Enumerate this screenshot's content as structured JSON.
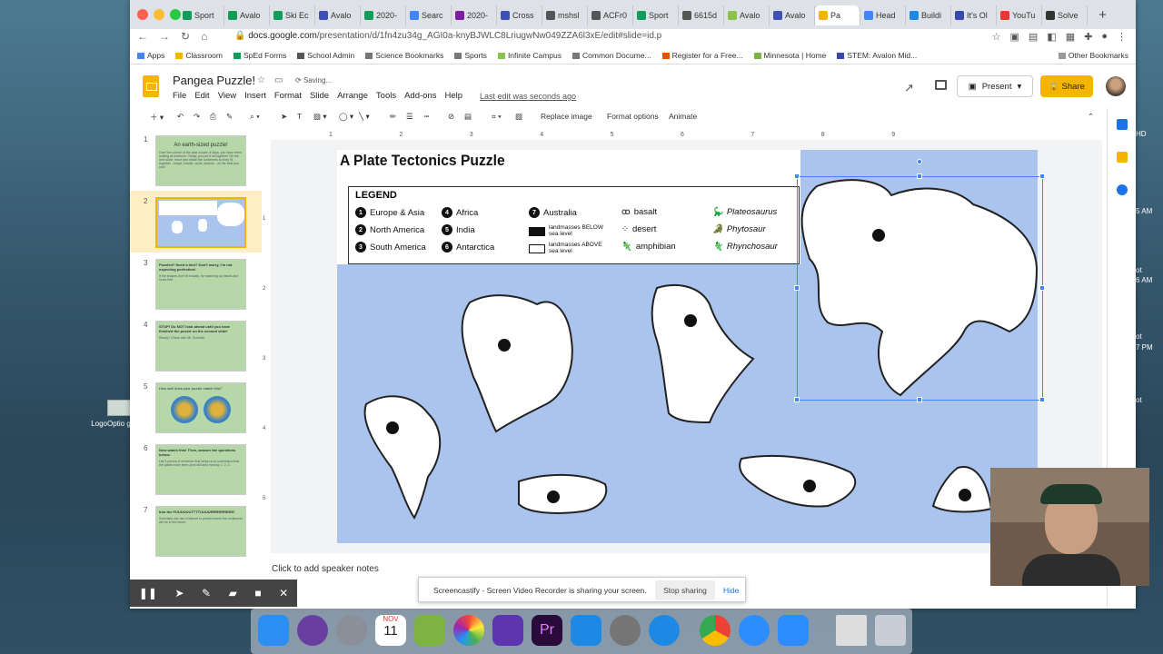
{
  "browser": {
    "tabs": [
      {
        "label": "Sport",
        "color": "#0f9d58"
      },
      {
        "label": "Avalo",
        "color": "#0f9d58"
      },
      {
        "label": "Ski Ec",
        "color": "#0f9d58"
      },
      {
        "label": "Avalo",
        "color": "#3f51b5"
      },
      {
        "label": "2020-",
        "color": "#0f9d58"
      },
      {
        "label": "Searc",
        "color": "#4285f4"
      },
      {
        "label": "2020-",
        "color": "#7b1fa2"
      },
      {
        "label": "Cross",
        "color": "#3f51b5"
      },
      {
        "label": "mshsl",
        "color": "#555555"
      },
      {
        "label": "ACFr0",
        "color": "#555555"
      },
      {
        "label": "Sport",
        "color": "#0f9d58"
      },
      {
        "label": "6615d",
        "color": "#555555"
      },
      {
        "label": "Avalo",
        "color": "#8bc34a"
      },
      {
        "label": "Avalo",
        "color": "#3f51b5"
      },
      {
        "label": "Pa",
        "color": "#f4b400"
      },
      {
        "label": "Head",
        "color": "#4285f4"
      },
      {
        "label": "Buildi",
        "color": "#1e88e5"
      },
      {
        "label": "It's Ol",
        "color": "#3949ab"
      },
      {
        "label": "YouTu",
        "color": "#e53935"
      },
      {
        "label": "Solve",
        "color": "#333333"
      }
    ],
    "url_host": "docs.google.com",
    "url_path": "/presentation/d/1fn4zu34g_AGI0a-knyBJWLC8LriugwNw049ZZA6l3xE/edit#slide=id.p",
    "bookmarks": [
      {
        "label": "Apps",
        "color": "#4285f4"
      },
      {
        "label": "Classroom",
        "color": "#f4b400"
      },
      {
        "label": "SpEd Forms",
        "color": "#0f9d58"
      },
      {
        "label": "School Admin",
        "color": "#555555"
      },
      {
        "label": "Science Bookmarks",
        "color": "#777777"
      },
      {
        "label": "Sports",
        "color": "#777777"
      },
      {
        "label": "Infinite Campus",
        "color": "#8bc34a"
      },
      {
        "label": "Common Docume...",
        "color": "#777777"
      },
      {
        "label": "Register for a Free...",
        "color": "#e65100"
      },
      {
        "label": "Minnesota | Home",
        "color": "#7cb342"
      },
      {
        "label": "STEM: Avalon Mid...",
        "color": "#3949ab"
      }
    ],
    "other_bookmarks": "Other Bookmarks"
  },
  "doc": {
    "title": "Pangea Puzzle!",
    "saving": "Saving...",
    "menu": [
      "File",
      "Edit",
      "View",
      "Insert",
      "Format",
      "Slide",
      "Arrange",
      "Tools",
      "Add-ons",
      "Help"
    ],
    "last_edit": "Last edit was seconds ago",
    "present": "Present",
    "share": "Share"
  },
  "toolbar": {
    "replace_image": "Replace image",
    "format_options": "Format options",
    "animate": "Animate"
  },
  "ruler": [
    "1",
    "2",
    "3",
    "4",
    "5",
    "6",
    "7",
    "8",
    "9"
  ],
  "vruler": [
    "1",
    "2",
    "3",
    "4",
    "5"
  ],
  "thumbnails": [
    {
      "num": "1",
      "title": "An earth-sized puzzle!",
      "body": "Over the course of the past couple of days, you have been looking at evidence. Today, you put it all together! On the next slide, move and rotate the continents so they fit together - shape, fossils, rocks, deserts - do the best you can!"
    },
    {
      "num": "2",
      "title": "",
      "body": ""
    },
    {
      "num": "3",
      "title": "Puzzled? Need a hint? Don't worry, I'm not expecting perfection!",
      "body": "If the shapes don't fit exactly, try matching up fossils and rocks first."
    },
    {
      "num": "4",
      "title": "STOP! Do NOT look ahead until you have finished the puzzle on the second slide!",
      "body": "Ready? Check with Mr. Schmidt."
    },
    {
      "num": "5",
      "title": "How well does your puzzle match this?",
      "body": ""
    },
    {
      "num": "6",
      "title": "Now watch this! Then, answer the questions below:",
      "body": "List 3 pieces of evidence that helps us to understand that the plates have been (and still are) moving: 1. 2. 3."
    },
    {
      "num": "7",
      "title": "Into the FUUUUUUTTTTUUUURRRRRREEE!",
      "body": "Scientists can use evidence to predict where the continents will be in the future."
    }
  ],
  "slide": {
    "title": "A Plate Tectonics Puzzle",
    "legend_title": "LEGEND",
    "legend": [
      {
        "n": "1",
        "label": "Europe & Asia"
      },
      {
        "n": "2",
        "label": "North America"
      },
      {
        "n": "3",
        "label": "South America"
      },
      {
        "n": "4",
        "label": "Africa"
      },
      {
        "n": "5",
        "label": "India"
      },
      {
        "n": "6",
        "label": "Antarctica"
      },
      {
        "n": "7",
        "label": "Australia"
      }
    ],
    "landmass_below": "landmasses BELOW sea level",
    "landmass_above": "landmasses ABOVE sea level",
    "rocks": [
      "basalt",
      "desert",
      "amphibian"
    ],
    "fossils": [
      "Plateosaurus",
      "Phytosaur",
      "Rhynchosaur"
    ],
    "colors": {
      "ocean": "#aac4ee",
      "accent": "#f4b400",
      "select": "#4285f4"
    }
  },
  "notes_placeholder": "Click to add speaker notes",
  "screencast": {
    "message": "Screencastify - Screen Video Recorder is sharing your screen.",
    "stop": "Stop sharing",
    "hide": "Hide"
  },
  "desktop": {
    "logo_label": "LogoOptio g",
    "side": [
      "HD",
      "5 AM",
      "ot",
      "6 AM",
      "ot",
      "7 PM",
      "ot"
    ]
  },
  "dock": {
    "calendar_month": "NOV",
    "calendar_day": "11"
  }
}
